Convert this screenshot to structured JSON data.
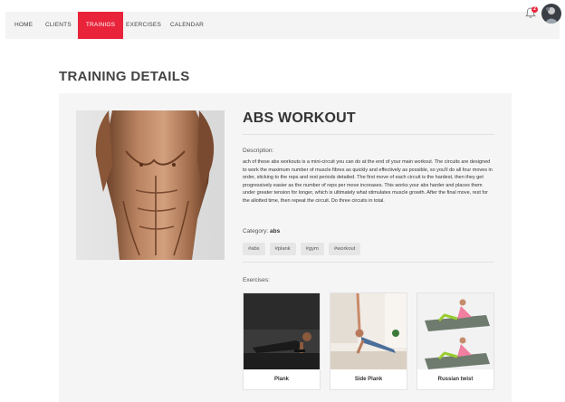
{
  "nav": {
    "items": [
      {
        "label": "HOME"
      },
      {
        "label": "CLIENTS"
      },
      {
        "label": "TRAINIGS"
      },
      {
        "label": "EXERCISES"
      },
      {
        "label": "CALENDAR"
      }
    ],
    "active_color": "#e9243a",
    "notification_icon": "bell-icon",
    "notification_badge": "2"
  },
  "page_title": "TRAINING DETAILS",
  "training": {
    "title": "ABS WORKOUT",
    "description_label": "Description:",
    "description": "ach of these abs workouts is a mini-circuit you can do at the end of your main workout. The circuits are designed to work the maximum number of muscle fibres as quickly and effectively as possible, so you'll do all four moves in order, sticking to the reps and rest periods detailed. The first move of each circuit is the hardest, then they get progressively easier as the number of reps per move increases. This works your abs harder and places them under greater tension for longer, which is ultimately what stimulates muscle growth. After the final move, rest for the allotted time, then repeat the circuit. Do three circuits in total.",
    "category_label": "Category:",
    "category": "abs",
    "tags": [
      "#abs",
      "#plank",
      "#gym",
      "#workout"
    ],
    "exercises_label": "Exercises:",
    "exercises": [
      {
        "name": "Plank"
      },
      {
        "name": "Side Plank"
      },
      {
        "name": "Russian twist"
      }
    ]
  }
}
